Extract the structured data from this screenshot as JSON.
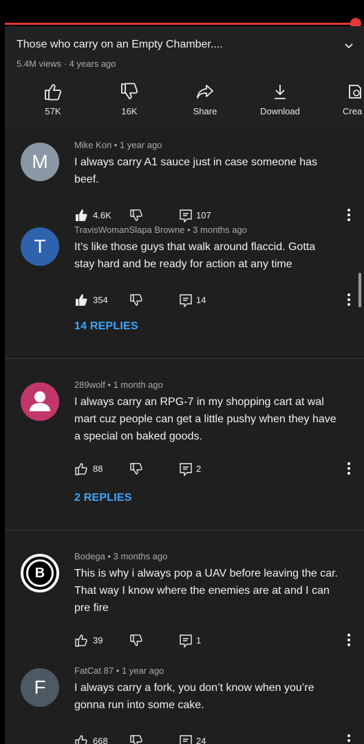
{
  "player": {
    "progress_percent": 100,
    "colors": {
      "accent": "#e53935"
    }
  },
  "video": {
    "title": "Those who carry on an Empty Chamber....",
    "meta": "5.4M views · 4 years ago",
    "actions": [
      {
        "label": "57K",
        "icon": "thumbs-up-icon"
      },
      {
        "label": "16K",
        "icon": "thumbs-down-icon"
      },
      {
        "label": "Share",
        "icon": "share-icon"
      },
      {
        "label": "Download",
        "icon": "download-icon"
      },
      {
        "label": "Crea",
        "icon": "create-clip-icon"
      }
    ]
  },
  "comments": [
    {
      "avatar_letter": "M",
      "avatar_color": "#8a98a6",
      "author_meta": "Mike Kon • 1 year ago",
      "lines": [
        "I always carry A1 sauce just in case someone has",
        "beef."
      ],
      "likes": "4.6K",
      "liked": true,
      "replies": "107"
    },
    {
      "avatar_letter": "T",
      "avatar_color": "#2f62ad",
      "author_meta": "TravisWomanSlapa Browne • 3 months ago",
      "lines": [
        "It’s like those guys that walk around flaccid. Gotta",
        "stay hard and be ready for action at any time"
      ],
      "likes": "354",
      "liked": true,
      "replies": "14",
      "replies_link": "14 REPLIES"
    },
    {
      "avatar_letter": "",
      "avatar_color": "#c2376b",
      "author_meta": "289wolf • 1 month ago",
      "lines": [
        "I always carry an RPG-7 in my shopping cart at wal",
        "mart cuz people can get a little pushy when they have",
        "a special on baked goods."
      ],
      "likes": "88",
      "liked": false,
      "replies": "2",
      "replies_link": "2 REPLIES"
    },
    {
      "avatar_letter": "B",
      "avatar_color": "#ffffff",
      "author_meta": "Bodega • 3 months ago",
      "lines": [
        "This is why i always pop a UAV before leaving the car.",
        "That way I know where the enemies are at and I can",
        "pre fire"
      ],
      "likes": "39",
      "liked": false,
      "replies": "1"
    },
    {
      "avatar_letter": "F",
      "avatar_color": "#4d5963",
      "author_meta": "FatCat 87 • 1 year ago",
      "lines": [
        "I always carry a fork, you don’t know when you’re",
        "gonna run into some cake."
      ],
      "likes": "668",
      "liked": false,
      "replies": "24"
    }
  ]
}
